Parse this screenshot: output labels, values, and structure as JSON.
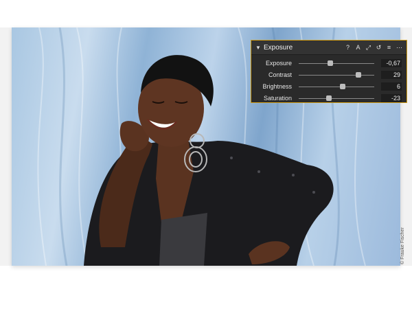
{
  "panel": {
    "title": "Exposure",
    "tools": [
      {
        "icon": "help-icon",
        "glyph": "?"
      },
      {
        "icon": "auto-adjust-icon",
        "glyph": "A"
      },
      {
        "icon": "copy-adjustments-icon",
        "glyph": "⤢"
      },
      {
        "icon": "reset-icon",
        "glyph": "↺"
      },
      {
        "icon": "presets-icon",
        "glyph": "≡"
      },
      {
        "icon": "more-icon",
        "glyph": "⋯"
      }
    ],
    "sliders": [
      {
        "label": "Exposure",
        "value": "-0,67",
        "level": 0.42
      },
      {
        "label": "Contrast",
        "value": "29",
        "level": 0.79
      },
      {
        "label": "Brightness",
        "value": "6",
        "level": 0.58
      },
      {
        "label": "Saturation",
        "value": "-23",
        "level": 0.4
      }
    ]
  },
  "photo": {
    "credit": "© Frauke Fischer"
  },
  "colors": {
    "panel_bg": "#2a2a2a",
    "accent_border": "#d4a017",
    "backdrop_blue": "#a9c7e2"
  }
}
